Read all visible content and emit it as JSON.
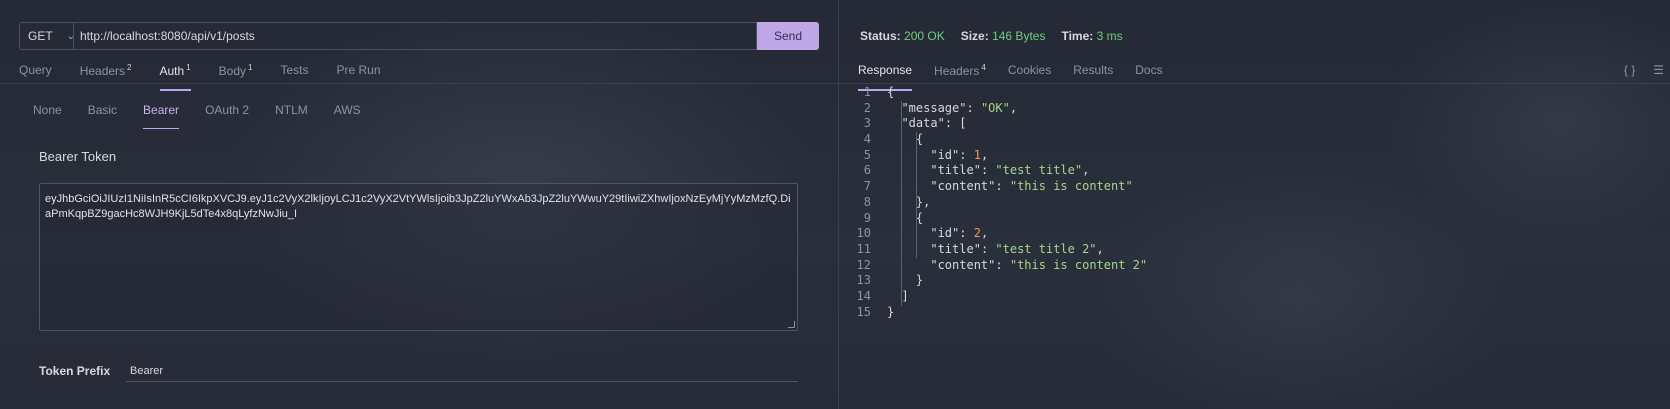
{
  "request": {
    "method": "GET",
    "url": "http://localhost:8080/api/v1/posts",
    "send_label": "Send"
  },
  "main_tabs": [
    {
      "label": "Query",
      "badge": ""
    },
    {
      "label": "Headers",
      "badge": "2"
    },
    {
      "label": "Auth",
      "badge": "1",
      "active": true
    },
    {
      "label": "Body",
      "badge": "1"
    },
    {
      "label": "Tests",
      "badge": ""
    },
    {
      "label": "Pre Run",
      "badge": ""
    }
  ],
  "auth_tabs": [
    {
      "label": "None"
    },
    {
      "label": "Basic"
    },
    {
      "label": "Bearer",
      "active": true
    },
    {
      "label": "OAuth 2"
    },
    {
      "label": "NTLM"
    },
    {
      "label": "AWS"
    }
  ],
  "auth": {
    "bearer_label": "Bearer Token",
    "token": "eyJhbGciOiJIUzI1NiIsInR5cCI6IkpXVCJ9.eyJ1c2VyX2lkIjoyLCJ1c2VyX2VtYWlsIjoib3JpZ2luYWxAb3JpZ2luYWwuY29tIiwiZXhwIjoxNzEyMjYyMzMzfQ.DiaPmKqpBZ9gacHc8WJH9KjL5dTe4x8qLyfzNwJiu_I",
    "prefix_label": "Token Prefix",
    "prefix_value": "Bearer"
  },
  "response": {
    "status_label": "Status:",
    "status_value": "200 OK",
    "size_label": "Size:",
    "size_value": "146 Bytes",
    "time_label": "Time:",
    "time_value": "3 ms",
    "tabs": [
      {
        "label": "Response",
        "badge": "",
        "active": true
      },
      {
        "label": "Headers",
        "badge": "4"
      },
      {
        "label": "Cookies",
        "badge": ""
      },
      {
        "label": "Results",
        "badge": ""
      },
      {
        "label": "Docs",
        "badge": ""
      }
    ],
    "icons": [
      "braces-icon",
      "menu-icon"
    ],
    "body_lines": [
      "{",
      "  \"message\": \"OK\",",
      "  \"data\": [",
      "    {",
      "      \"id\": 1,",
      "      \"title\": \"test title\",",
      "      \"content\": \"this is content\"",
      "    },",
      "    {",
      "      \"id\": 2,",
      "      \"title\": \"test title 2\",",
      "      \"content\": \"this is content 2\"",
      "    }",
      "  ]",
      "}"
    ]
  },
  "colors": {
    "accent": "#bfa6e6",
    "success": "#6fcf7a",
    "string": "#a6d68a",
    "number": "#e89a6a"
  }
}
